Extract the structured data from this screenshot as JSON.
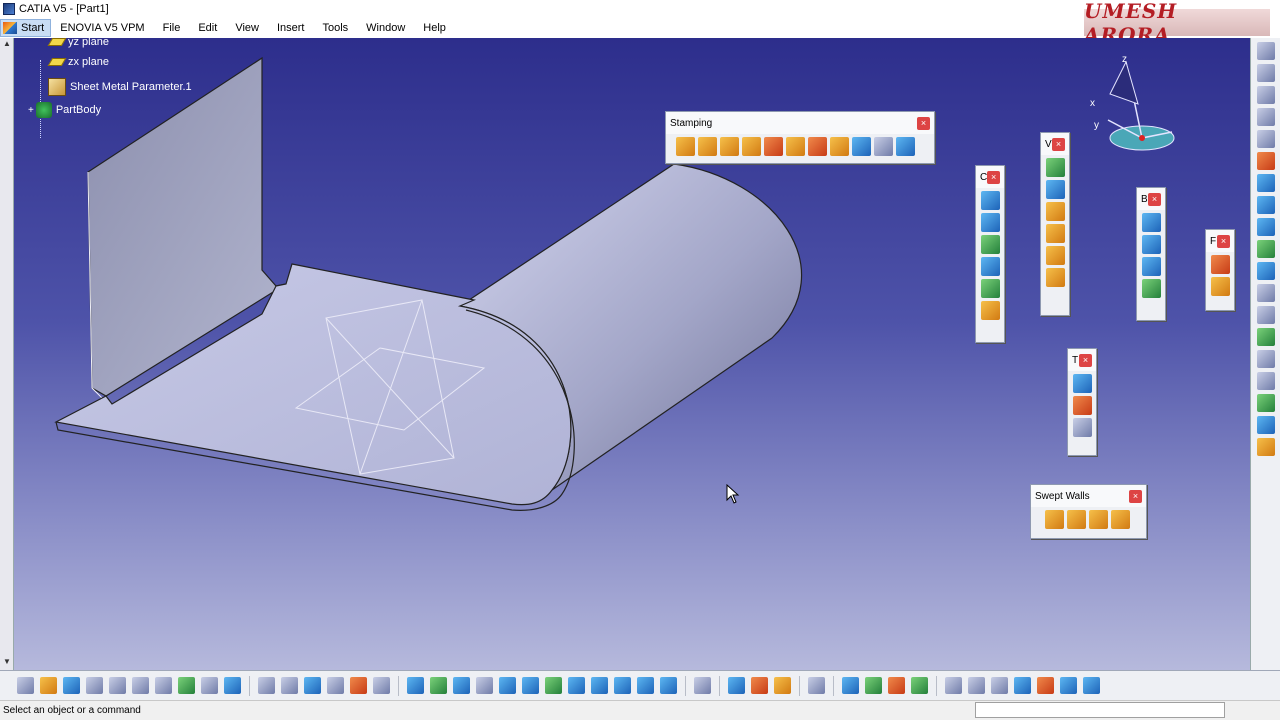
{
  "window": {
    "title": "CATIA V5 - [Part1]"
  },
  "menubar": {
    "items": [
      "Start",
      "ENOVIA V5 VPM",
      "File",
      "Edit",
      "View",
      "Insert",
      "Tools",
      "Window",
      "Help"
    ]
  },
  "logo": {
    "text": "UMESH ARORA"
  },
  "tree": {
    "items": [
      {
        "label": "yz plane",
        "icon": "plane-icon"
      },
      {
        "label": "zx plane",
        "icon": "plane-icon"
      },
      {
        "label": "Sheet Metal Parameter.1",
        "icon": "sheet-metal-parameters-icon"
      },
      {
        "label": "PartBody",
        "icon": "part-body-icon"
      }
    ]
  },
  "toolbars": {
    "stamping": {
      "title": "Stamping",
      "icon_count": 11
    },
    "cutting": {
      "title": "C",
      "icon_count": 6
    },
    "view": {
      "title": "V",
      "icon_count": 6
    },
    "bending": {
      "title": "B",
      "icon_count": 4
    },
    "forming": {
      "title": "F",
      "icon_count": 2
    },
    "transform": {
      "title": "T",
      "icon_count": 3
    },
    "swept_walls": {
      "title": "Swept Walls",
      "icon_count": 4
    }
  },
  "compass": {
    "axes": [
      "x",
      "y",
      "z"
    ]
  },
  "statusbar": {
    "message": "Select an object or a command",
    "command_input": ""
  }
}
